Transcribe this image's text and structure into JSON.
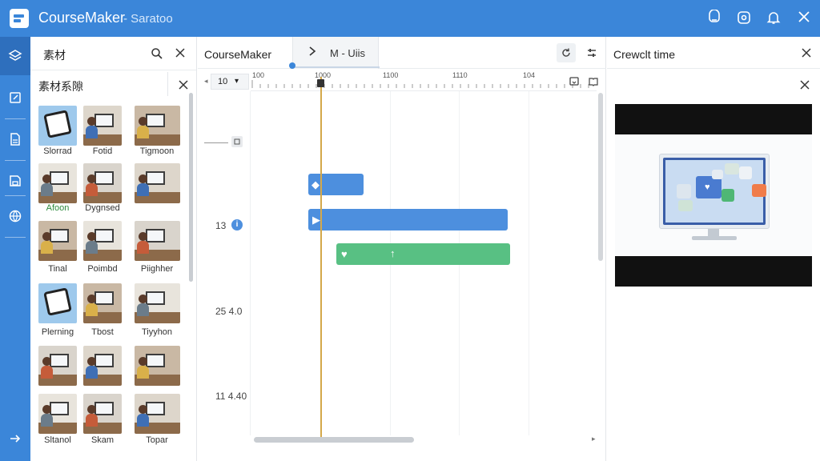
{
  "app": {
    "title": "CourseMaker",
    "subtitle": "- Saratoo"
  },
  "colors": {
    "accent": "#3b86d9",
    "clip_blue": "#4d8fde",
    "clip_green": "#58c083",
    "playhead": "#d4a84a"
  },
  "header_icons": [
    "chat-icon",
    "settings-badge-icon",
    "bell-icon",
    "close-icon"
  ],
  "rail": {
    "items": [
      "layers-icon",
      "edit-icon",
      "document-icon",
      "save-icon",
      "globe-icon",
      "export-icon"
    ]
  },
  "assets": {
    "title": "素材",
    "subtitle": "素材系隙",
    "tiles": [
      {
        "label": "Slorrad",
        "kind": "tablet"
      },
      {
        "label": "Fotid",
        "kind": "photo"
      },
      {
        "label": "Tigmoon",
        "kind": "photo"
      },
      {
        "label": "Afoon",
        "kind": "photo"
      },
      {
        "label": "Dygnsed",
        "kind": "photo"
      },
      {
        "label": "",
        "kind": "photo"
      },
      {
        "label": "Tinal",
        "kind": "photo"
      },
      {
        "label": "Poimbd",
        "kind": "photo"
      },
      {
        "label": "Piighher",
        "kind": "photo"
      },
      {
        "label": "Plerning",
        "kind": "tablet"
      },
      {
        "label": "Tbost",
        "kind": "photo"
      },
      {
        "label": "Tiyyhon",
        "kind": "photo"
      },
      {
        "label": "",
        "kind": "photo"
      },
      {
        "label": "",
        "kind": "photo"
      },
      {
        "label": "",
        "kind": "photo"
      },
      {
        "label": "Sltanol",
        "kind": "photo"
      },
      {
        "label": "Skam",
        "kind": "photo"
      },
      {
        "label": "Topar",
        "kind": "photo"
      }
    ]
  },
  "timeline": {
    "title": "CourseMaker",
    "tab_label": "M  -  Uiis",
    "zoom": "10",
    "ruler_ticks": [
      "100",
      "1000",
      "1100",
      "1110",
      "104"
    ],
    "track_labels": [
      "13",
      "25 4.0",
      "11 4.40"
    ]
  },
  "preview": {
    "title": "Crewclt time"
  }
}
